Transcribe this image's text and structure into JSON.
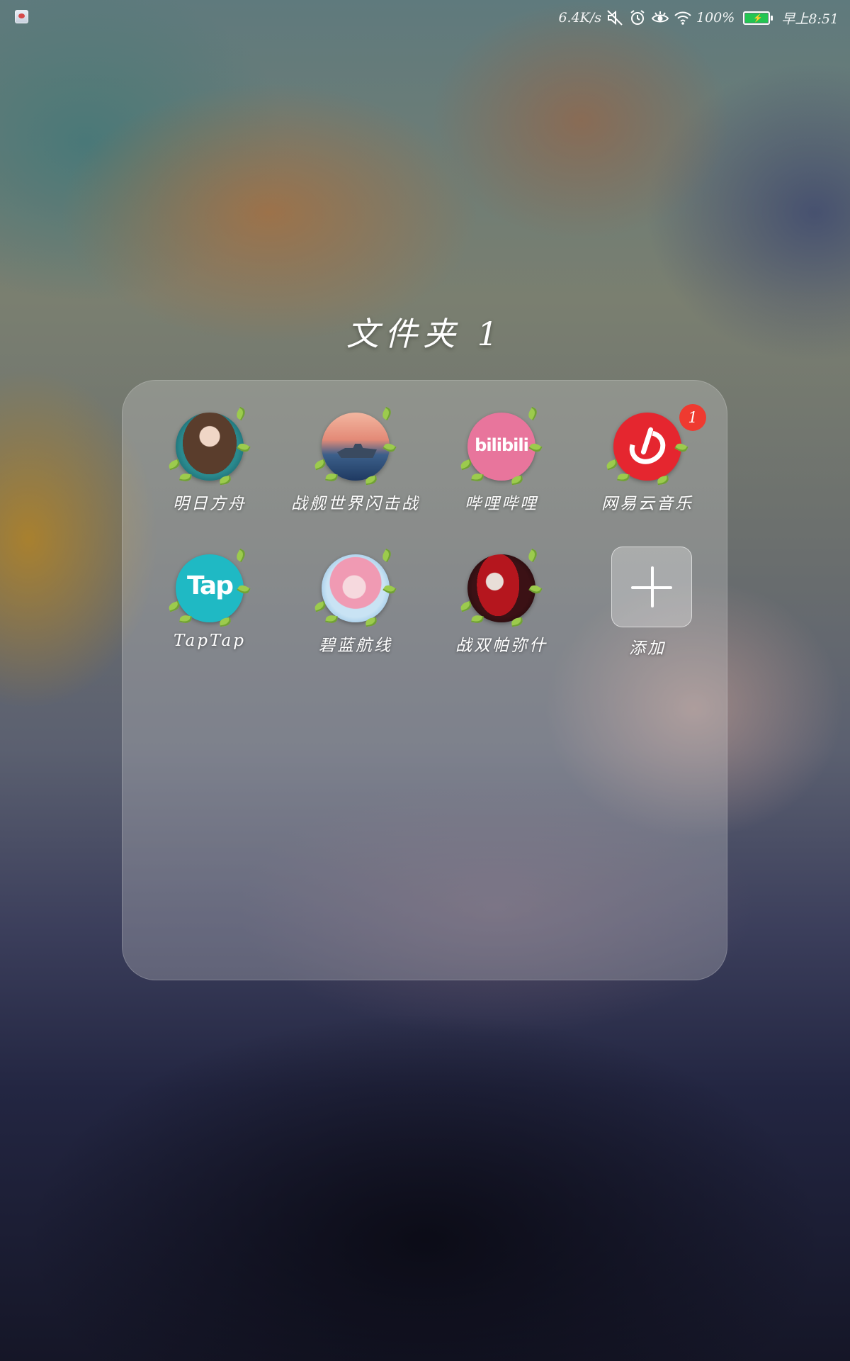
{
  "status_bar": {
    "net_speed": "6.4K/s",
    "icons": [
      "notification-app-icon",
      "mute-icon",
      "alarm-icon",
      "eye-comfort-icon",
      "wifi-icon",
      "battery-icon"
    ],
    "battery_percent": "100%",
    "battery_level": 1.0,
    "time": "早上8:51",
    "battery_color": "#23c552"
  },
  "folder": {
    "title": "文件夹 1",
    "apps": [
      {
        "label": "明日方舟",
        "icon": "arknights-icon"
      },
      {
        "label": "战舰世界闪击战",
        "icon": "world-of-warships-blitz-icon"
      },
      {
        "label": "哔哩哔哩",
        "icon": "bilibili-icon",
        "icon_text": "bilibili"
      },
      {
        "label": "网易云音乐",
        "icon": "netease-cloud-music-icon",
        "badge": "1"
      },
      {
        "label": "TapTap",
        "icon": "taptap-icon",
        "icon_text": "Tap"
      },
      {
        "label": "碧蓝航线",
        "icon": "azur-lane-icon"
      },
      {
        "label": "战双帕弥什",
        "icon": "punishing-gray-raven-icon"
      }
    ],
    "add_label": "添加",
    "badge_color": "#ef3a30"
  }
}
